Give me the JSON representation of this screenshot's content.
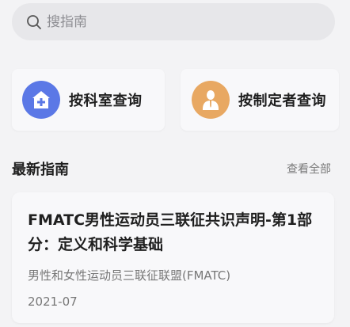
{
  "search": {
    "placeholder": "搜指南",
    "value": ""
  },
  "quick_actions": {
    "by_department": {
      "label": "按科室查询",
      "icon": "hospital-plus-icon",
      "color": "#5b78e6"
    },
    "by_maker": {
      "label": "按制定者查询",
      "icon": "doctor-person-icon",
      "color": "#e8a862"
    }
  },
  "latest": {
    "title": "最新指南",
    "see_all": "查看全部",
    "items": [
      {
        "title": "FMATC男性运动员三联征共识声明-第1部分：定义和科学基础",
        "org": "男性和女性运动员三联征联盟(FMATC)",
        "date": "2021-07"
      }
    ]
  }
}
